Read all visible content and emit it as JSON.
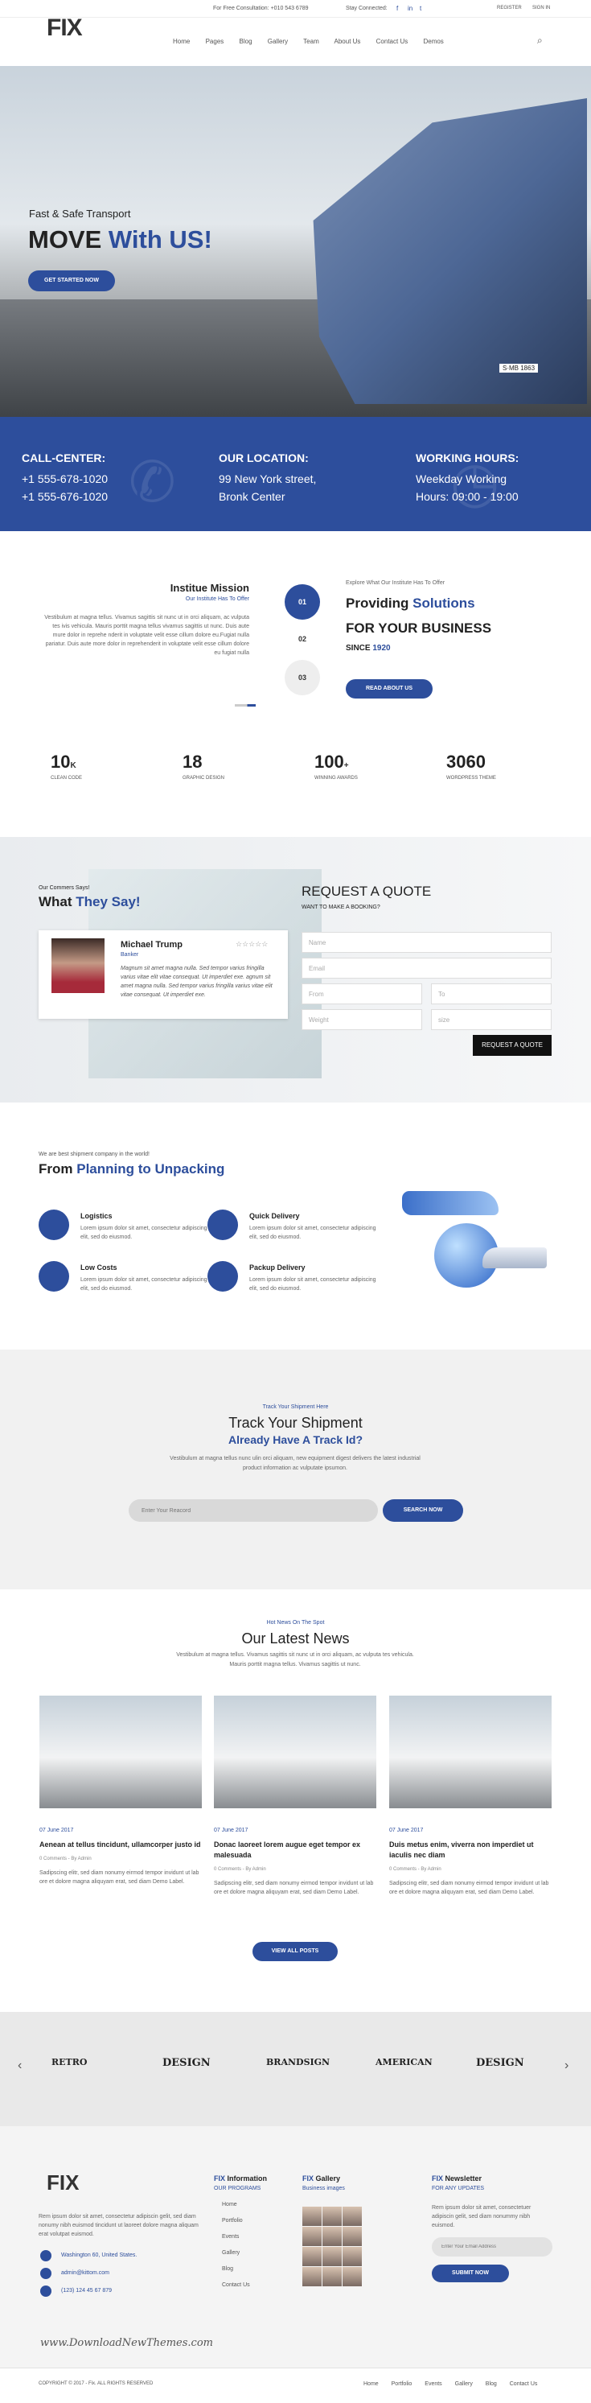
{
  "topbar": {
    "consult": "For Free Consultation: +010 543 6789",
    "stay": "Stay Connected:",
    "register": "REGISTER",
    "signin": "SIGN IN"
  },
  "logo": "FIX",
  "nav": [
    "Home",
    "Pages",
    "Blog",
    "Gallery",
    "Team",
    "About Us",
    "Contact Us",
    "Demos"
  ],
  "hero": {
    "pre": "Fast & Safe Transport",
    "title_a": "MOVE",
    "title_b": "With US!",
    "button": "GET STARTED NOW",
    "plate": "S·MB 1863"
  },
  "band": {
    "c1": {
      "h": "CALL-CENTER:",
      "l1": "+1 555-678-1020",
      "l2": "+1 555-676-1020"
    },
    "c2": {
      "h": "OUR LOCATION:",
      "l1": "99 New York street,",
      "l2": "Bronk Center"
    },
    "c3": {
      "h": "WORKING HOURS:",
      "l1": "Weekday Working",
      "l2": "Hours: 09:00 - 19:00"
    }
  },
  "mission": {
    "title": "Institue Mission",
    "sub": "Our Institute Has To Offer",
    "text": "Vestibulum at magna tellus. Vivamus sagittis sit nunc ut in orci aliquam, ac vulputa tes ivis vehicula. Mauris porttit magna tellus vivamus sagittis ut nunc. Duis aute mure dolor in reprehe nderit in voluptate velit esse cillum dolore eu.Fugiat nulla pariatur. Duis aute more dolor in reprehenderit in voluptate velit esse cillum dolore eu fugiat nulla",
    "steps": [
      "01",
      "02",
      "03"
    ],
    "what": "Explore What Our Institute Has To Offer",
    "prov_a": "Providing",
    "prov_b": "Solutions",
    "forbiz": "FOR YOUR BUSINESS",
    "since_a": "SINCE",
    "since_b": "1920",
    "button": "READ ABOUT US"
  },
  "stats": [
    {
      "n": "10",
      "s": "K",
      "l": "CLEAN CODE"
    },
    {
      "n": "18",
      "s": "",
      "l": "GRAPHIC DESIGN"
    },
    {
      "n": "100",
      "s": "+",
      "l": "WINNING AWARDS"
    },
    {
      "n": "3060",
      "s": "",
      "l": "WORDPRESS THEME"
    }
  ],
  "testimonial": {
    "pre": "Our Commers Says!",
    "title_a": "What",
    "title_b": "They Say!",
    "name": "Michael Trump",
    "role": "Banker",
    "stars": "☆☆☆☆☆",
    "quote": "Magnum sit amet magna nulla. Sed tempor varius fringilla varius vitae elit vitae consequat. Ut imperdiet exe. agnum sit amet magna nulla. Sed tempor varius fringilla varius vitae elit vitae consequat. Ut imperdiet exe."
  },
  "quote": {
    "title": "REQUEST A QUOTE",
    "sub": "WANT TO MAKE A BOOKING?",
    "name": "Name",
    "email": "Email",
    "from": "From",
    "to": "To",
    "weight": "Weight",
    "size": "size",
    "button": "REQUEST A QUOTE"
  },
  "features": {
    "pre": "We are best shipment company in the world!",
    "title_a": "From",
    "title_b": "Planning to Unpacking",
    "items": [
      {
        "t": "Logistics",
        "d": "Lorem ipsum dolor sit amet, consectetur adipiscing elit, sed do eiusmod."
      },
      {
        "t": "Quick Delivery",
        "d": "Lorem ipsum dolor sit amet, consectetur adipiscing elit, sed do eiusmod."
      },
      {
        "t": "Low Costs",
        "d": "Lorem ipsum dolor sit amet, consectetur adipiscing elit, sed do eiusmod."
      },
      {
        "t": "Packup Delivery",
        "d": "Lorem ipsum dolor sit amet, consectetur adipiscing elit, sed do eiusmod."
      }
    ]
  },
  "track": {
    "pre": "Track Your Shipment Here",
    "title": "Track Your Shipment",
    "sub": "Already Have A Track Id?",
    "text": "Vestibulum at magna tellus nunc ulin orci aliquam, new equipment digest delivers the latest industrial product information ac vulputate ipsumon.",
    "placeholder": "Enter Your Reacord",
    "button": "SEARCH NOW"
  },
  "newsSec": {
    "pre": "Hot News On The Spot",
    "title": "Our Latest News",
    "text": "Vestibulum at magna tellus. Vivamus sagittis sit nunc ut in orci aliquam, ac vulputa tes vehicula. Mauris porttit magna tellus. Vivamus sagittis ut nunc.",
    "button": "VIEW ALL POSTS"
  },
  "news": [
    {
      "date": "07 June 2017",
      "t": "Aenean at tellus tincidunt, ullamcorper justo id",
      "m": "0 Comments  -  By Admin",
      "d": "Sadipscing elitr, sed diam nonumy eirmod tempor invidunt ut lab ore et dolore magna aliquyam erat, sed diam Demo Label."
    },
    {
      "date": "07 June 2017",
      "t": "Donac laoreet lorem augue eget tempor ex malesuada",
      "m": "0 Comments  -  By Admin",
      "d": "Sadipscing elitr, sed diam nonumy eirmod tempor invidunt ut lab ore et dolore magna aliquyam erat, sed diam Demo Label."
    },
    {
      "date": "07 June 2017",
      "t": "Duis metus enim, viverra non imperdiet ut iaculis nec diam",
      "m": "0 Comments  -  By Admin",
      "d": "Sadipscing elitr, sed diam nonumy eirmod tempor invidunt ut lab ore et dolore magna aliquyam erat, sed diam Demo Label."
    }
  ],
  "brands": [
    "RETRO",
    "DESIGN",
    "BRANDSIGN",
    "AMERICAN",
    "DESIGN"
  ],
  "footer": {
    "text": "Rem ipsum dolor sit amet, consectetur adipiscin gelit, sed diam nonumy nibh euismod tincidunt ut laoreet dolore magna aliquam erat volutpat euismod.",
    "addr": "Washington 60, United States.",
    "mail": "admin@kittom.com",
    "phone": "(123) 124 45 67 879",
    "info_a": "FIX",
    "info_b": "Information",
    "info_sub": "OUR PROGRAMS",
    "links": [
      "Home",
      "Portfolio",
      "Events",
      "Gallery",
      "Blog",
      "Contact Us"
    ],
    "gal_a": "FIX",
    "gal_b": "Gallery",
    "gal_sub": "Business images",
    "news_a": "FIX",
    "news_b": "Newsletter",
    "news_sub": "FOR ANY UPDATES",
    "news_text": "Rem ipsum dolor sit amet, consectetuer adipiscin gelit, sed diam nonummy nibh euismod.",
    "placeholder": "Enter Your Email Address",
    "button": "SUBMIT NOW",
    "watermark": "www.DownloadNewThemes.com"
  },
  "copyright": {
    "text": "COPYRIGHT © 2017 - Fix. ALL RIGHTS RESERVED",
    "links": [
      "Home",
      "Portfolio",
      "Events",
      "Gallery",
      "Blog",
      "Contact Us"
    ]
  }
}
